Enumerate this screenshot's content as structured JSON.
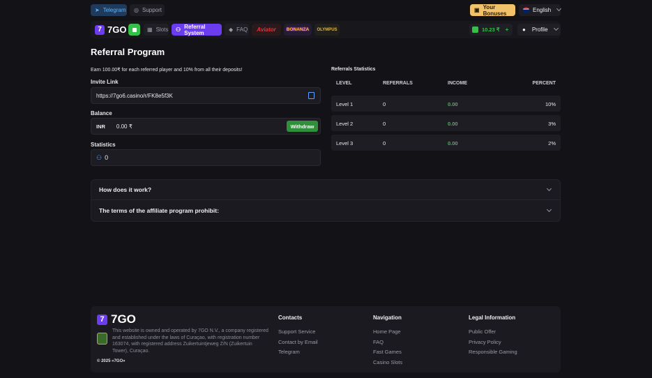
{
  "topbar": {
    "telegram": "Telegram",
    "support": "Support",
    "bonuses": "Your Bonuses",
    "language": "English"
  },
  "nav": {
    "brand": "7GO",
    "slots": "Slots",
    "referral": "Referral System",
    "faq": "FAQ",
    "aviator": "Aviator",
    "bonanza": "BONANZA",
    "olympus": "OLYMPUS",
    "balance": "10.23 ₹",
    "profile": "Profile"
  },
  "page": {
    "title": "Referral Program",
    "earn_text": "Earn 100.00₹ for each referred player and 10% from all their deposits!"
  },
  "invite": {
    "label": "Invite Link",
    "value": "https://7go6.casino/r/FK8e5f3K"
  },
  "balance": {
    "label": "Balance",
    "currency": "INR",
    "amount": "0.00 ₹",
    "withdraw": "Withdraw"
  },
  "statistics": {
    "label": "Statistics",
    "count": "0"
  },
  "ref_stats": {
    "title": "Referrals Statistics",
    "headers": [
      "LEVEL",
      "REFERRALS",
      "INCOME",
      "PERCENT"
    ],
    "rows": [
      {
        "level": "Level 1",
        "referrals": "0",
        "income": "0.00",
        "percent": "10%"
      },
      {
        "level": "Level 2",
        "referrals": "0",
        "income": "0.00",
        "percent": "3%"
      },
      {
        "level": "Level 3",
        "referrals": "0",
        "income": "0.00",
        "percent": "2%"
      }
    ]
  },
  "faq": {
    "q1": "How does it work?",
    "q2": "The terms of the affiliate program prohibit:"
  },
  "footer": {
    "brand": "7GO",
    "about": "This website is owned and operated by 7GO N.V., a company registered and established under the laws of Curaçao, with registration number 163074, with registered address Zuikertuintjeweg Z/N (Zuikertuin Tower), Curaçao.",
    "copyright": "© 2025 «7GO»",
    "contacts": {
      "title": "Contacts",
      "links": [
        "Support Service",
        "Contact by Email",
        "Telegram"
      ]
    },
    "navigation": {
      "title": "Navigation",
      "links": [
        "Home Page",
        "FAQ",
        "Fast Games",
        "Casino Slots"
      ]
    },
    "legal": {
      "title": "Legal Information",
      "links": [
        "Public Offer",
        "Privacy Policy",
        "Responsible Gaming"
      ]
    }
  },
  "colors": {
    "accent_purple": "#6b3cf0",
    "green": "#35c04a",
    "gold": "#f2c26a"
  }
}
